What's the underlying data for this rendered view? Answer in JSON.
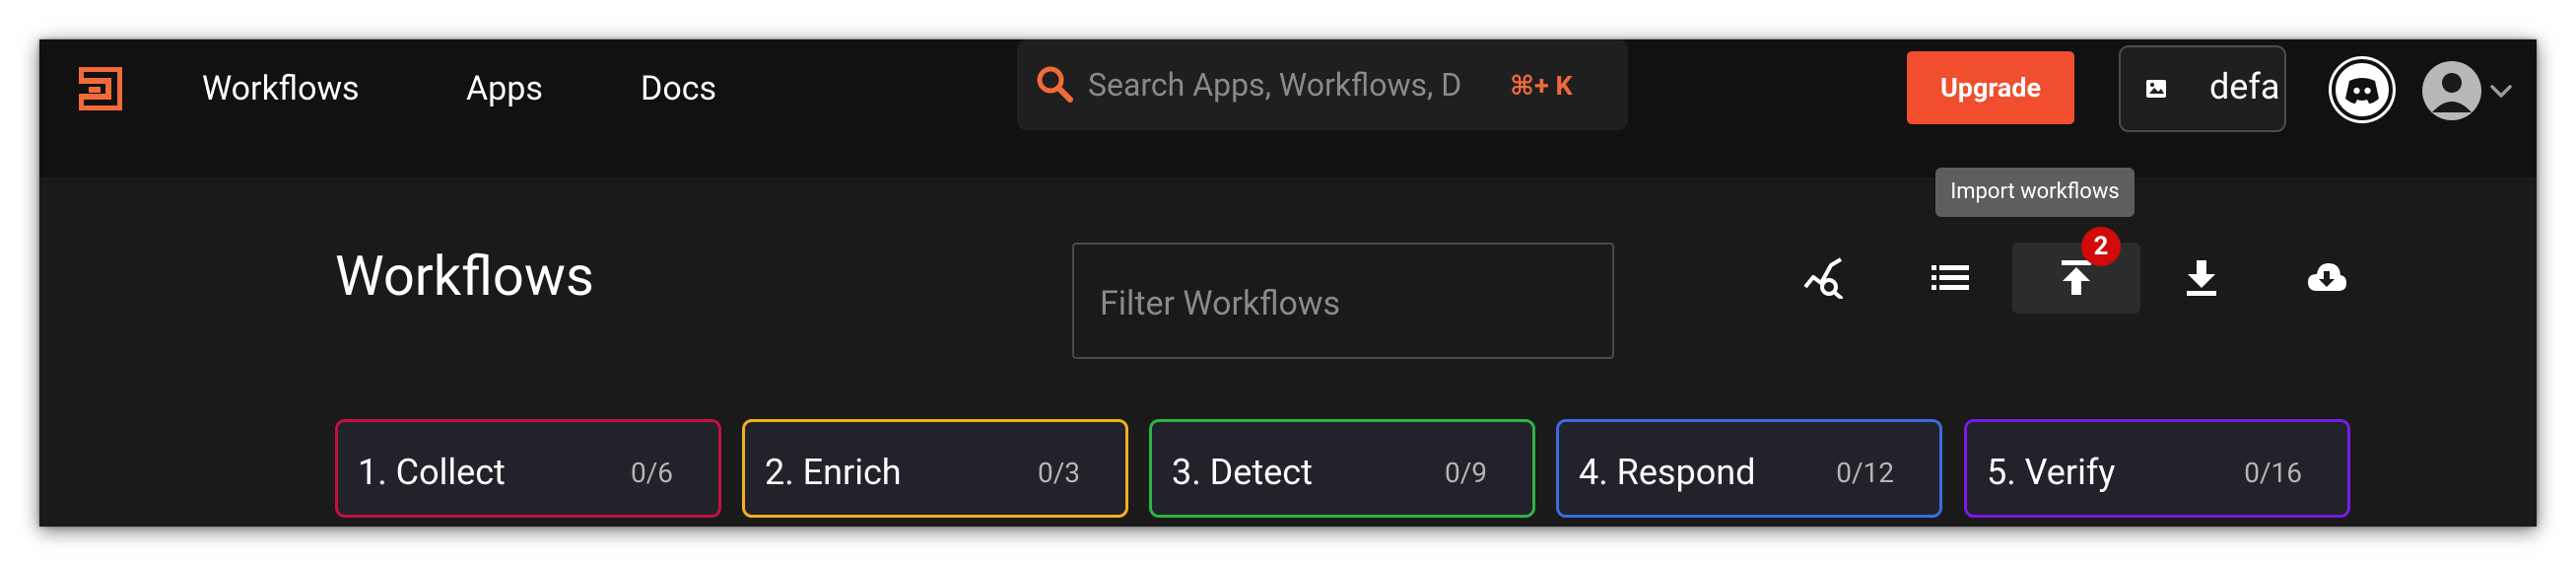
{
  "nav": {
    "items": [
      {
        "label": "Workflows"
      },
      {
        "label": "Apps"
      },
      {
        "label": "Docs"
      }
    ]
  },
  "search": {
    "placeholder": "Search Apps, Workflows, D",
    "shortcut": "⌘+ K"
  },
  "header": {
    "upgrade_label": "Upgrade",
    "org_name": "defa"
  },
  "tooltip": {
    "text": "Import workflows"
  },
  "page": {
    "title": "Workflows",
    "filter_placeholder": "Filter Workflows"
  },
  "toolbar": {
    "badge_count": "2",
    "icons": [
      "analytics-search-icon",
      "list-icon",
      "upload-icon",
      "download-icon",
      "cloud-download-icon"
    ]
  },
  "stages": [
    {
      "name": "1. Collect",
      "count": "0/6",
      "color": "#c2103f"
    },
    {
      "name": "2. Enrich",
      "count": "0/3",
      "color": "#f2b01e"
    },
    {
      "name": "3. Detect",
      "count": "0/9",
      "color": "#2fb344"
    },
    {
      "name": "4. Respond",
      "count": "0/12",
      "color": "#3a6be0"
    },
    {
      "name": "5. Verify",
      "count": "0/16",
      "color": "#7a19e8"
    }
  ],
  "colors": {
    "accent": "#f04e2f",
    "background": "#1a1a1a",
    "topbar": "#111111"
  }
}
